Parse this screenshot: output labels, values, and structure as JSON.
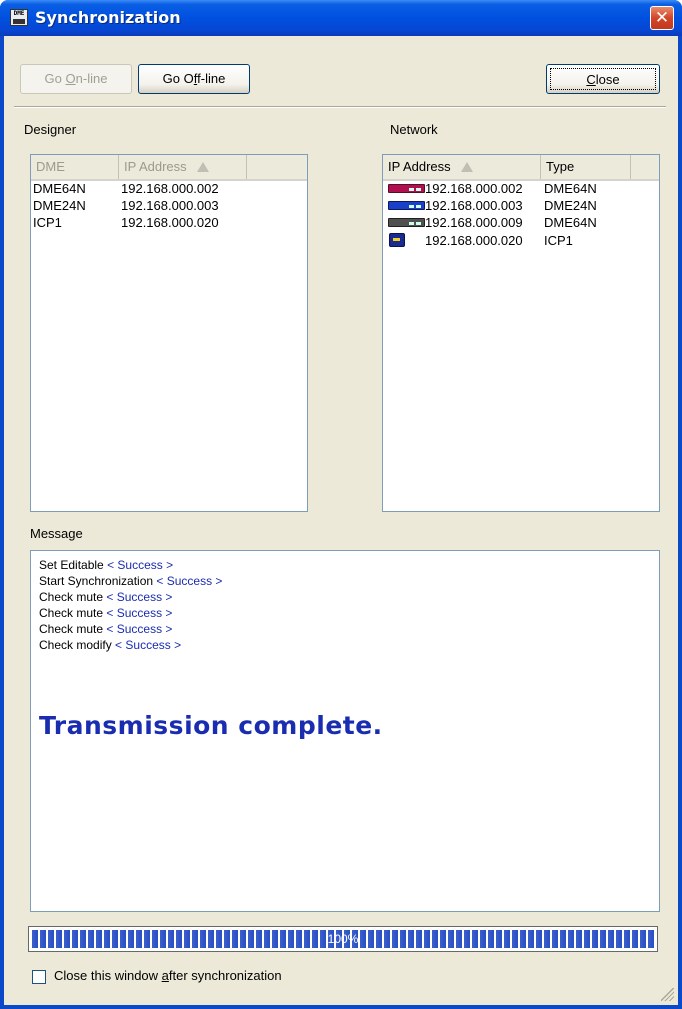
{
  "window": {
    "title": "Synchronization",
    "icon_label": "DME"
  },
  "toolbar": {
    "go_online": {
      "before": "Go ",
      "mnemonic": "O",
      "after": "n-line",
      "enabled": false
    },
    "go_offline": {
      "before": "Go O",
      "mnemonic": "f",
      "after": "f-line",
      "enabled": true
    },
    "close": {
      "before": "",
      "mnemonic": "C",
      "after": "lose"
    }
  },
  "designer": {
    "label": "Designer",
    "columns": [
      "DME",
      "IP Address"
    ],
    "rows": [
      {
        "dme": "DME64N",
        "ip": "192.168.000.002"
      },
      {
        "dme": "DME24N",
        "ip": "192.168.000.003"
      },
      {
        "dme": "ICP1",
        "ip": "192.168.000.020"
      }
    ]
  },
  "network": {
    "label": "Network",
    "columns": [
      "IP Address",
      "Type"
    ],
    "rows": [
      {
        "ip": "192.168.000.002",
        "type": "DME64N",
        "icon": "dme-red-unit-icon"
      },
      {
        "ip": "192.168.000.003",
        "type": "DME24N",
        "icon": "dme-blue-unit-icon"
      },
      {
        "ip": "192.168.000.009",
        "type": "DME64N",
        "icon": "dme-grey-unit-icon"
      },
      {
        "ip": "192.168.000.020",
        "type": "ICP1",
        "icon": "icp-panel-icon"
      }
    ]
  },
  "message": {
    "label": "Message",
    "lines": [
      {
        "text": "Set Editable",
        "status": "< Success >"
      },
      {
        "text": "Start Synchronization",
        "status": "< Success >"
      },
      {
        "text": "Check mute",
        "status": "< Success >"
      },
      {
        "text": "Check mute",
        "status": "< Success >"
      },
      {
        "text": "Check mute",
        "status": "< Success >"
      },
      {
        "text": "Check modify",
        "status": "< Success >"
      }
    ],
    "complete": "Transmission complete."
  },
  "progress": {
    "label": "100%",
    "value": 1.0
  },
  "footer": {
    "checkbox": {
      "before": "Close this window ",
      "mnemonic": "a",
      "after": "fter synchronization",
      "checked": false
    }
  },
  "colors": {
    "title_bar": "#0050e0",
    "success_text": "#1a2db0",
    "progress_fill": "#3a5fcf",
    "dialog_bg": "#ece9d8"
  }
}
